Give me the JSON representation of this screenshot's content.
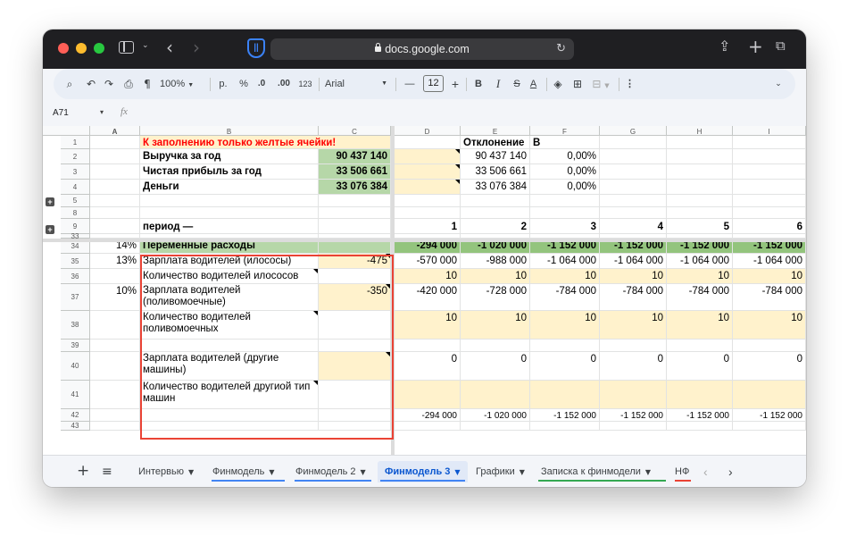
{
  "browser": {
    "url": "docs.google.com"
  },
  "toolbar": {
    "zoom": "100%",
    "paint_format": "p.",
    "percent": "%",
    "dec_decrease": ".0",
    "dec_increase": ".00",
    "number_format": "123",
    "font": "Arial",
    "font_size": "12",
    "minus": "—",
    "plus": "+",
    "bold": "B",
    "italic": "I",
    "strike": "S",
    "text_color": "A",
    "more": "⋮"
  },
  "formula_bar": {
    "name_box": "A71",
    "fx": "fx"
  },
  "columns": [
    "A",
    "B",
    "C",
    "D",
    "E",
    "F",
    "G",
    "H",
    "I"
  ],
  "rows": [
    {
      "num": "1",
      "b": "К заполнению только желтые ячейки!",
      "c": "",
      "d": "",
      "e": "Отклонение",
      "f": "В процентах",
      "g": "",
      "h": "",
      "i": ""
    },
    {
      "num": "2",
      "b": "Выручка за год",
      "c": "90 437 140",
      "d": "",
      "e": "90 437 140",
      "f": "0,00%",
      "g": "",
      "h": "",
      "i": ""
    },
    {
      "num": "3",
      "b": "Чистая прибыль за год",
      "c": "33 506 661",
      "d": "",
      "e": "33 506 661",
      "f": "0,00%",
      "g": "",
      "h": "",
      "i": ""
    },
    {
      "num": "4",
      "b": "Деньги",
      "c": "33 076 384",
      "d": "",
      "e": "33 076 384",
      "f": "0,00%",
      "g": "",
      "h": "",
      "i": ""
    },
    {
      "num": "5"
    },
    {
      "num": "8"
    },
    {
      "num": "9",
      "b": "период —",
      "d": "1",
      "e": "2",
      "f": "3",
      "g": "4",
      "h": "5",
      "i": "6"
    },
    {
      "num": "33"
    },
    {
      "num": "34",
      "a": "14%",
      "b": "Переменные расходы",
      "d": "-294 000",
      "e": "-1 020 000",
      "f": "-1 152 000",
      "g": "-1 152 000",
      "h": "-1 152 000",
      "i": "-1 152 000"
    },
    {
      "num": "35",
      "a": "13%",
      "b": "Зарплата водителей (илососы)",
      "c": "-475",
      "d": "-570 000",
      "e": "-988 000",
      "f": "-1 064 000",
      "g": "-1 064 000",
      "h": "-1 064 000",
      "i": "-1 064 000"
    },
    {
      "num": "36",
      "b": "Количество водителей илососов",
      "d": "10",
      "e": "10",
      "f": "10",
      "g": "10",
      "h": "10",
      "i": "10"
    },
    {
      "num": "37",
      "a": "10%",
      "b": "Зарплата водителей (поливомоечные)",
      "c": "-350",
      "d": "-420 000",
      "e": "-728 000",
      "f": "-784 000",
      "g": "-784 000",
      "h": "-784 000",
      "i": "-784 000"
    },
    {
      "num": "38",
      "b": "Количество водителей поливомоечных",
      "d": "10",
      "e": "10",
      "f": "10",
      "g": "10",
      "h": "10",
      "i": "10"
    },
    {
      "num": "39"
    },
    {
      "num": "40",
      "b": "Зарплата водителей (другие машины)",
      "d": "0",
      "e": "0",
      "f": "0",
      "g": "0",
      "h": "0",
      "i": "0"
    },
    {
      "num": "41",
      "b": "Количество водителей другиой тип машин"
    },
    {
      "num": "42",
      "d": "-294 000",
      "e": "-1 020 000",
      "f": "-1 152 000",
      "g": "-1 152 000",
      "h": "-1 152 000",
      "i": "-1 152 000"
    },
    {
      "num": "43"
    }
  ],
  "tabs": [
    {
      "label": "Интервью"
    },
    {
      "label": "Финмодель"
    },
    {
      "label": "Финмодель 2"
    },
    {
      "label": "Финмодель 3"
    },
    {
      "label": "Графики"
    },
    {
      "label": "Записка к финмодели"
    },
    {
      "label": "НФ"
    }
  ],
  "colors": {
    "yellow_cell": "#fff2cc",
    "green_cell": "#b6d7a8",
    "header_green": "#93c47d",
    "highlight_box": "#ea4335",
    "warning_text": "#ff0000",
    "active_tab": "#0b57d0"
  }
}
